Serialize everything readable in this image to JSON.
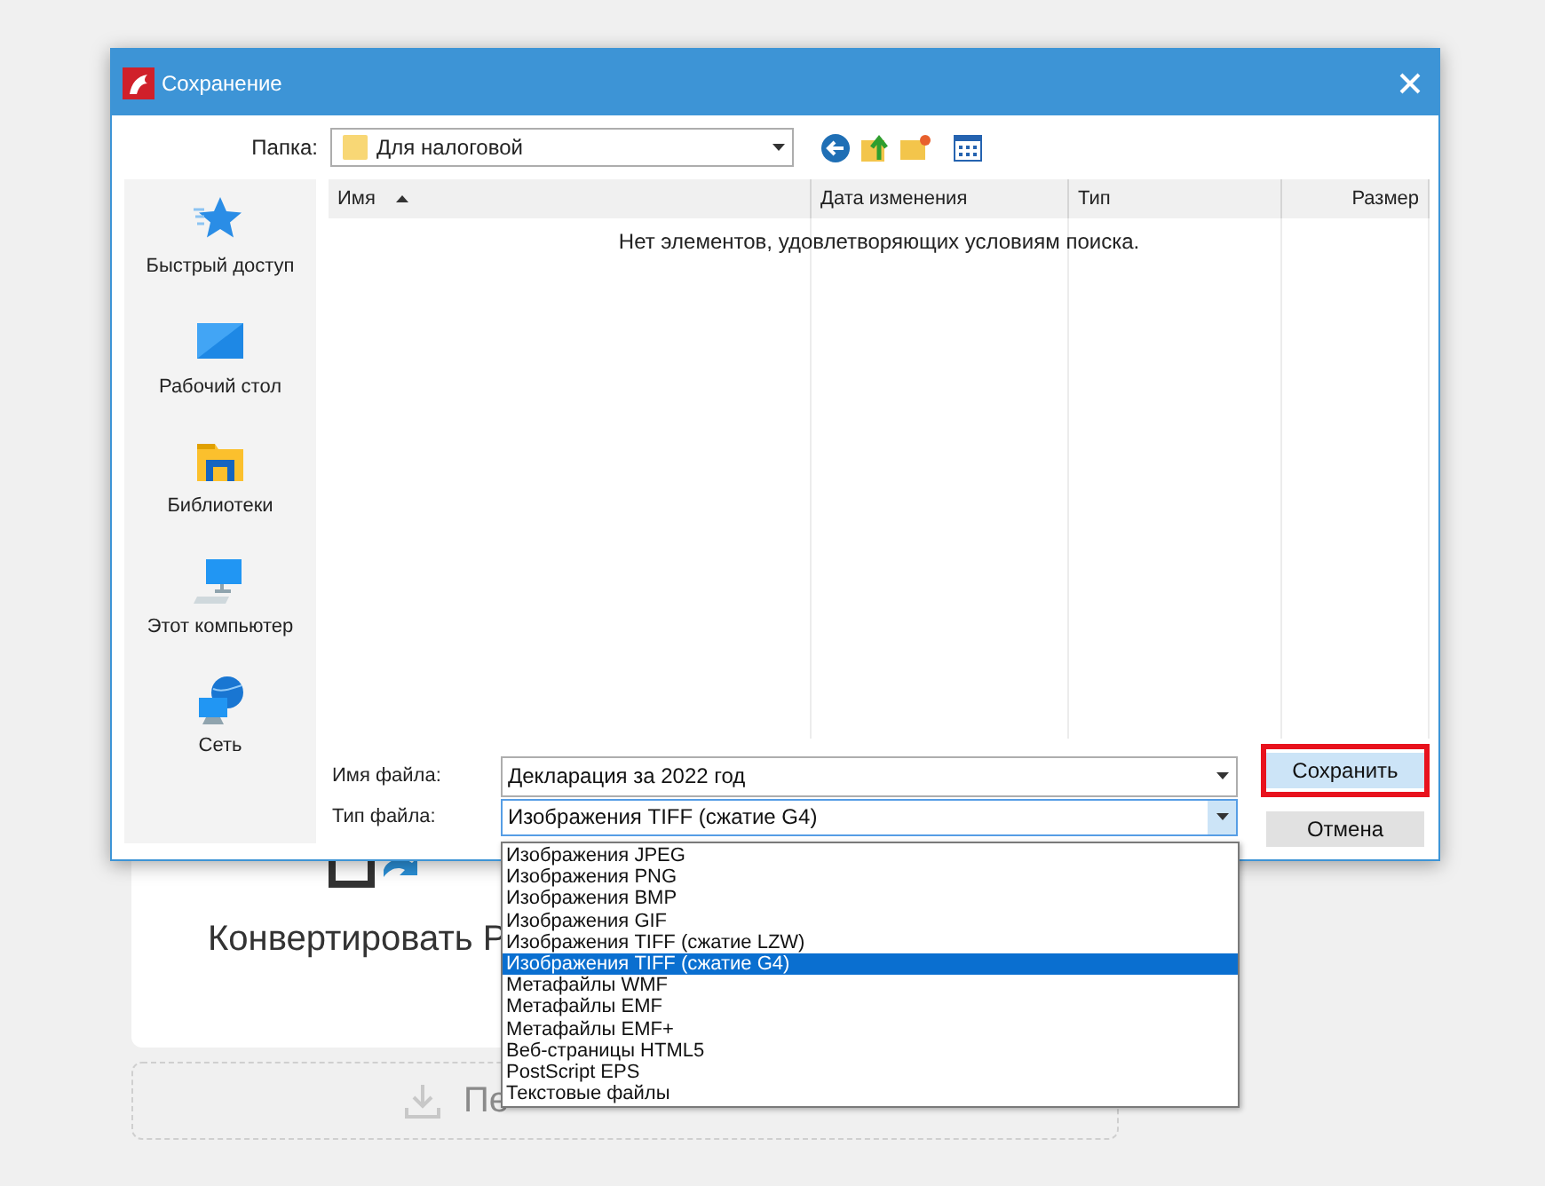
{
  "background": {
    "heading": "Конвертировать Р",
    "upload_label": "Пе"
  },
  "window": {
    "title": "Сохранение"
  },
  "folder": {
    "label": "Папка:",
    "value": "Для налоговой"
  },
  "sidebar": {
    "items": [
      {
        "kind": "star",
        "label": "Быстрый доступ"
      },
      {
        "kind": "desktop",
        "label": "Рабочий стол"
      },
      {
        "kind": "library",
        "label": "Библиотеки"
      },
      {
        "kind": "computer",
        "label": "Этот компьютер"
      },
      {
        "kind": "network",
        "label": "Сеть"
      }
    ]
  },
  "file_list": {
    "columns": [
      {
        "label": "Имя",
        "sorted": true
      },
      {
        "label": "Дата изменения",
        "sorted": false
      },
      {
        "label": "Тип",
        "sorted": false
      },
      {
        "label": "Размер",
        "sorted": false
      }
    ],
    "empty_message": "Нет элементов, удовлетворяющих условиям поиска."
  },
  "file_name": {
    "label": "Имя файла:",
    "value": "Декларация за 2022 год"
  },
  "file_type": {
    "label": "Тип файла:",
    "value": "Изображения TIFF (сжатие G4)",
    "expanded": true,
    "options": [
      {
        "label": "Изображения JPEG",
        "selected": false
      },
      {
        "label": "Изображения PNG",
        "selected": false
      },
      {
        "label": "Изображения BMP",
        "selected": false
      },
      {
        "label": "Изображения GIF",
        "selected": false
      },
      {
        "label": "Изображения TIFF (сжатие LZW)",
        "selected": false
      },
      {
        "label": "Изображения TIFF (сжатие G4)",
        "selected": true
      },
      {
        "label": "Метафайлы WMF",
        "selected": false
      },
      {
        "label": "Метафайлы EMF",
        "selected": false
      },
      {
        "label": "Метафайлы EMF+",
        "selected": false
      },
      {
        "label": "Веб-страницы HTML5",
        "selected": false
      },
      {
        "label": "PostScript EPS",
        "selected": false
      },
      {
        "label": "Текстовые файлы",
        "selected": false
      }
    ]
  },
  "buttons": [
    {
      "label": "Сохранить",
      "highlighted": true
    },
    {
      "label": "Отмена",
      "highlighted": false
    }
  ]
}
